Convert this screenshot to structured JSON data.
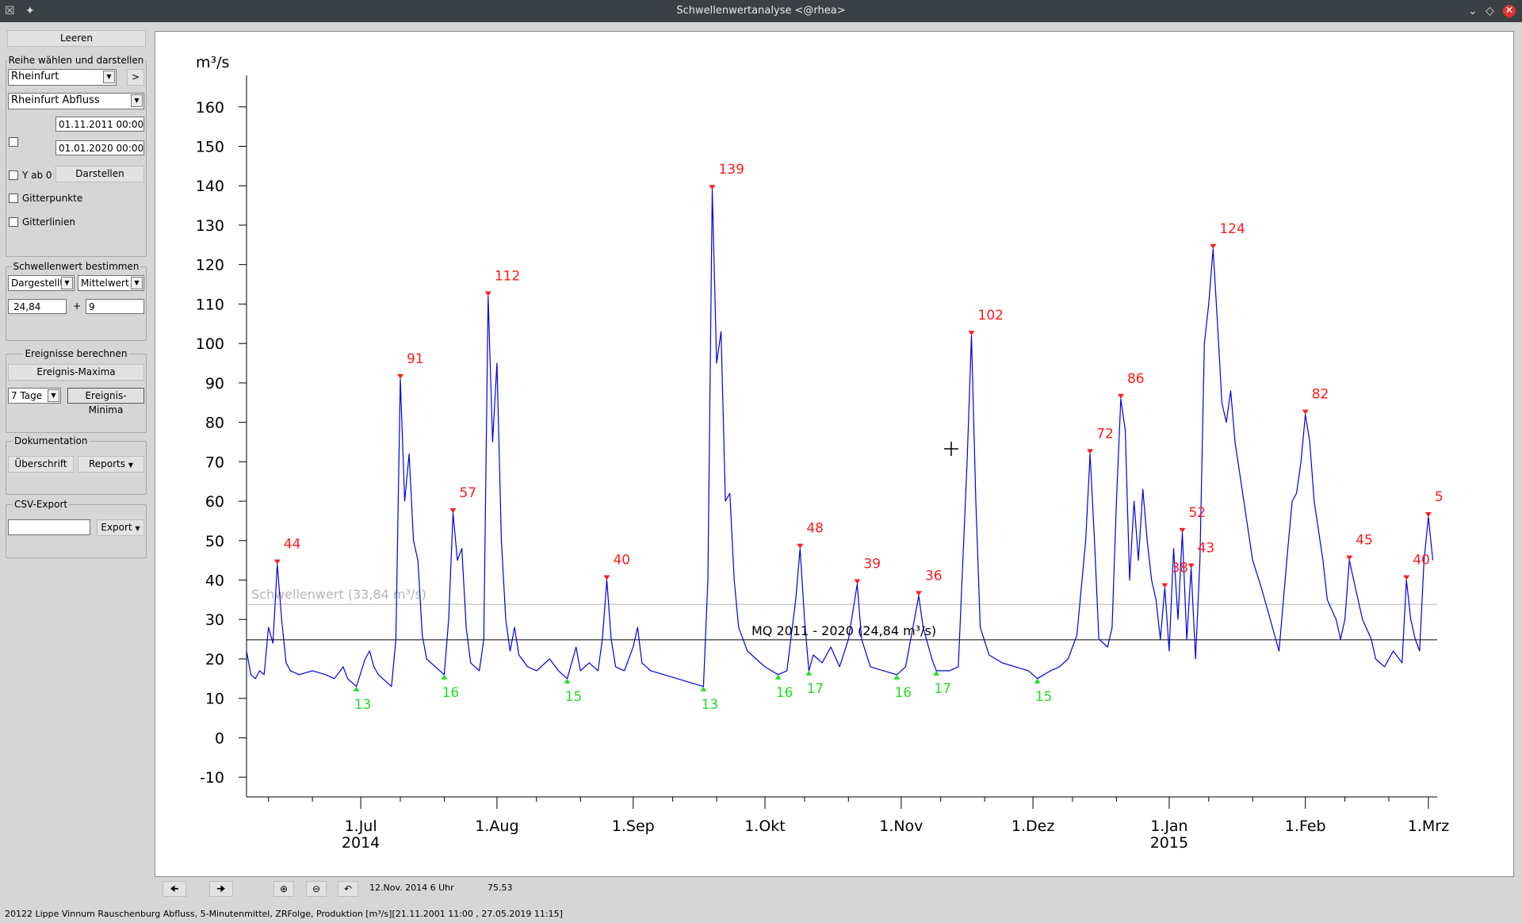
{
  "window": {
    "title": "Schwellenwertanalyse <@rhea>"
  },
  "left": {
    "leeren": "Leeren",
    "reihe": {
      "title": "Reihe wählen und darstellen",
      "station": "Rheinfurt",
      "next": ">",
      "series": "Rheinfurt Abfluss",
      "start": "01.11.2011 00:00",
      "end": "01.01.2020 00:00",
      "yab0": "Y ab 0",
      "darstellen": "Darstellen",
      "gitterpunkte": "Gitterpunkte",
      "gitterlinien": "Gitterlinien"
    },
    "schwelle": {
      "title": "Schwellenwert bestimmen",
      "mode": "Dargestellt",
      "stat": "Mittelwert",
      "value": "24,84",
      "plus": "+",
      "offset": "9"
    },
    "ereignisse": {
      "title": "Ereignisse berechnen",
      "maxima": "Ereignis-Maxima",
      "period": "7 Tage",
      "minima": "Ereignis-Minima"
    },
    "doku": {
      "title": "Dokumentation",
      "ueberschrift": "Überschrift",
      "reports": "Reports"
    },
    "csv": {
      "title": "CSV-Export",
      "value": "",
      "export": "Export"
    }
  },
  "status": {
    "cursor_date": "12.Nov. 2014 6 Uhr",
    "cursor_value": "75.53",
    "footer": "20122 Lippe Vinnum Rauschenburg  Abfluss, 5-Minutenmittel, ZRFolge, Produktion [m³/s][21.11.2001 11:00 , 27.05.2019 11:15]"
  },
  "colors": {
    "series": "#0000dd",
    "maxima": "#ff1a1a",
    "minima": "#22dd22",
    "threshold": "#b4b4b4",
    "mean": "#000000"
  },
  "chart_data": {
    "type": "line",
    "ylabel": "m³/s",
    "ylim": [
      -15,
      168
    ],
    "yticks": [
      -10,
      0,
      10,
      20,
      30,
      40,
      50,
      60,
      70,
      80,
      90,
      100,
      110,
      120,
      130,
      140,
      150,
      160
    ],
    "xlim": [
      "2014-06-05",
      "2015-03-03"
    ],
    "xticks": [
      {
        "date": "2014-07-01",
        "label": "1.Jul",
        "sub": "2014"
      },
      {
        "date": "2014-08-01",
        "label": "1.Aug",
        "sub": ""
      },
      {
        "date": "2014-09-01",
        "label": "1.Sep",
        "sub": ""
      },
      {
        "date": "2014-10-01",
        "label": "1.Okt",
        "sub": ""
      },
      {
        "date": "2014-11-01",
        "label": "1.Nov",
        "sub": ""
      },
      {
        "date": "2014-12-01",
        "label": "1.Dez",
        "sub": ""
      },
      {
        "date": "2015-01-01",
        "label": "1.Jan",
        "sub": "2015"
      },
      {
        "date": "2015-02-01",
        "label": "1.Feb",
        "sub": ""
      },
      {
        "date": "2015-03-01",
        "label": "1.Mrz",
        "sub": ""
      }
    ],
    "minor_ticks": [
      "2014-06-10",
      "2014-06-20",
      "2014-07-10",
      "2014-07-20",
      "2014-08-10",
      "2014-08-20",
      "2014-09-10",
      "2014-09-20",
      "2014-10-10",
      "2014-10-20",
      "2014-11-10",
      "2014-11-20",
      "2014-12-10",
      "2014-12-20",
      "2015-01-10",
      "2015-01-20",
      "2015-02-10",
      "2015-02-20"
    ],
    "threshold": {
      "value": 33.84,
      "label": "Schwellenwert  (33,84 m³/s)"
    },
    "mean": {
      "value": 24.84,
      "label": "MQ 2011 - 2020 (24,84 m³/s)"
    },
    "maxima": [
      {
        "date": "2014-06-12",
        "value": 44,
        "label": "44"
      },
      {
        "date": "2014-07-10",
        "value": 91,
        "label": "91"
      },
      {
        "date": "2014-07-22",
        "value": 57,
        "label": "57"
      },
      {
        "date": "2014-07-30",
        "value": 112,
        "label": "112"
      },
      {
        "date": "2014-08-26",
        "value": 40,
        "label": "40"
      },
      {
        "date": "2014-09-19",
        "value": 139,
        "label": "139"
      },
      {
        "date": "2014-10-09",
        "value": 48,
        "label": "48"
      },
      {
        "date": "2014-10-22",
        "value": 39,
        "label": "39"
      },
      {
        "date": "2014-11-05",
        "value": 36,
        "label": "36"
      },
      {
        "date": "2014-11-17",
        "value": 102,
        "label": "102"
      },
      {
        "date": "2014-12-14",
        "value": 72,
        "label": "72"
      },
      {
        "date": "2014-12-21",
        "value": 86,
        "label": "86"
      },
      {
        "date": "2014-12-31",
        "value": 38,
        "label": "38"
      },
      {
        "date": "2015-01-04",
        "value": 52,
        "label": "52"
      },
      {
        "date": "2015-01-06",
        "value": 43,
        "label": "43"
      },
      {
        "date": "2015-01-11",
        "value": 124,
        "label": "124"
      },
      {
        "date": "2015-02-01",
        "value": 82,
        "label": "82"
      },
      {
        "date": "2015-02-11",
        "value": 45,
        "label": "45"
      },
      {
        "date": "2015-02-24",
        "value": 40,
        "label": "40"
      },
      {
        "date": "2015-03-01",
        "value": 56,
        "label": "5"
      }
    ],
    "minima": [
      {
        "date": "2014-06-30",
        "value": 13,
        "label": "13"
      },
      {
        "date": "2014-07-20",
        "value": 16,
        "label": "16"
      },
      {
        "date": "2014-08-17",
        "value": 15,
        "label": "15"
      },
      {
        "date": "2014-09-17",
        "value": 13,
        "label": "13"
      },
      {
        "date": "2014-10-04",
        "value": 16,
        "label": "16"
      },
      {
        "date": "2014-10-11",
        "value": 17,
        "label": "17"
      },
      {
        "date": "2014-10-31",
        "value": 16,
        "label": "16"
      },
      {
        "date": "2014-11-09",
        "value": 17,
        "label": "17"
      },
      {
        "date": "2014-12-02",
        "value": 15,
        "label": "15"
      }
    ],
    "series": [
      {
        "values": [
          [
            "2014-06-05",
            22
          ],
          [
            "2014-06-06",
            16
          ],
          [
            "2014-06-07",
            15
          ],
          [
            "2014-06-08",
            17
          ],
          [
            "2014-06-09",
            16
          ],
          [
            "2014-06-10",
            28
          ],
          [
            "2014-06-11",
            24
          ],
          [
            "2014-06-12",
            44
          ],
          [
            "2014-06-13",
            30
          ],
          [
            "2014-06-14",
            19
          ],
          [
            "2014-06-15",
            17
          ],
          [
            "2014-06-17",
            16
          ],
          [
            "2014-06-20",
            17
          ],
          [
            "2014-06-23",
            16
          ],
          [
            "2014-06-25",
            15
          ],
          [
            "2014-06-27",
            18
          ],
          [
            "2014-06-28",
            15
          ],
          [
            "2014-06-30",
            13
          ],
          [
            "2014-07-02",
            20
          ],
          [
            "2014-07-03",
            22
          ],
          [
            "2014-07-04",
            18
          ],
          [
            "2014-07-05",
            16
          ],
          [
            "2014-07-07",
            14
          ],
          [
            "2014-07-08",
            13
          ],
          [
            "2014-07-09",
            25
          ],
          [
            "2014-07-10",
            91
          ],
          [
            "2014-07-11",
            60
          ],
          [
            "2014-07-12",
            72
          ],
          [
            "2014-07-13",
            50
          ],
          [
            "2014-07-14",
            45
          ],
          [
            "2014-07-15",
            26
          ],
          [
            "2014-07-16",
            20
          ],
          [
            "2014-07-18",
            18
          ],
          [
            "2014-07-20",
            16
          ],
          [
            "2014-07-21",
            30
          ],
          [
            "2014-07-22",
            57
          ],
          [
            "2014-07-23",
            45
          ],
          [
            "2014-07-24",
            48
          ],
          [
            "2014-07-25",
            28
          ],
          [
            "2014-07-26",
            19
          ],
          [
            "2014-07-28",
            17
          ],
          [
            "2014-07-29",
            25
          ],
          [
            "2014-07-30",
            112
          ],
          [
            "2014-07-31",
            75
          ],
          [
            "2014-08-01",
            95
          ],
          [
            "2014-08-02",
            50
          ],
          [
            "2014-08-03",
            30
          ],
          [
            "2014-08-04",
            22
          ],
          [
            "2014-08-05",
            28
          ],
          [
            "2014-08-06",
            21
          ],
          [
            "2014-08-08",
            18
          ],
          [
            "2014-08-10",
            17
          ],
          [
            "2014-08-13",
            20
          ],
          [
            "2014-08-15",
            17
          ],
          [
            "2014-08-17",
            15
          ],
          [
            "2014-08-19",
            23
          ],
          [
            "2014-08-20",
            17
          ],
          [
            "2014-08-22",
            19
          ],
          [
            "2014-08-24",
            17
          ],
          [
            "2014-08-25",
            25
          ],
          [
            "2014-08-26",
            40
          ],
          [
            "2014-08-27",
            25
          ],
          [
            "2014-08-28",
            18
          ],
          [
            "2014-08-30",
            17
          ],
          [
            "2014-09-01",
            23
          ],
          [
            "2014-09-02",
            28
          ],
          [
            "2014-09-03",
            19
          ],
          [
            "2014-09-05",
            17
          ],
          [
            "2014-09-08",
            16
          ],
          [
            "2014-09-11",
            15
          ],
          [
            "2014-09-14",
            14
          ],
          [
            "2014-09-17",
            13
          ],
          [
            "2014-09-18",
            40
          ],
          [
            "2014-09-19",
            139
          ],
          [
            "2014-09-20",
            95
          ],
          [
            "2014-09-21",
            103
          ],
          [
            "2014-09-22",
            60
          ],
          [
            "2014-09-23",
            62
          ],
          [
            "2014-09-24",
            40
          ],
          [
            "2014-09-25",
            28
          ],
          [
            "2014-09-27",
            22
          ],
          [
            "2014-09-29",
            20
          ],
          [
            "2014-10-01",
            18
          ],
          [
            "2014-10-04",
            16
          ],
          [
            "2014-10-06",
            17
          ],
          [
            "2014-10-08",
            35
          ],
          [
            "2014-10-09",
            48
          ],
          [
            "2014-10-10",
            30
          ],
          [
            "2014-10-11",
            17
          ],
          [
            "2014-10-12",
            21
          ],
          [
            "2014-10-14",
            19
          ],
          [
            "2014-10-16",
            23
          ],
          [
            "2014-10-18",
            18
          ],
          [
            "2014-10-20",
            25
          ],
          [
            "2014-10-22",
            39
          ],
          [
            "2014-10-23",
            25
          ],
          [
            "2014-10-25",
            18
          ],
          [
            "2014-10-28",
            17
          ],
          [
            "2014-10-31",
            16
          ],
          [
            "2014-11-02",
            18
          ],
          [
            "2014-11-04",
            30
          ],
          [
            "2014-11-05",
            36
          ],
          [
            "2014-11-06",
            28
          ],
          [
            "2014-11-08",
            20
          ],
          [
            "2014-11-09",
            17
          ],
          [
            "2014-11-12",
            17
          ],
          [
            "2014-11-14",
            18
          ],
          [
            "2014-11-16",
            70
          ],
          [
            "2014-11-17",
            102
          ],
          [
            "2014-11-18",
            60
          ],
          [
            "2014-11-19",
            28
          ],
          [
            "2014-11-21",
            21
          ],
          [
            "2014-11-24",
            19
          ],
          [
            "2014-11-27",
            18
          ],
          [
            "2014-11-30",
            17
          ],
          [
            "2014-12-02",
            15
          ],
          [
            "2014-12-05",
            17
          ],
          [
            "2014-12-07",
            18
          ],
          [
            "2014-12-09",
            20
          ],
          [
            "2014-12-11",
            26
          ],
          [
            "2014-12-13",
            50
          ],
          [
            "2014-12-14",
            72
          ],
          [
            "2014-12-15",
            50
          ],
          [
            "2014-12-16",
            25
          ],
          [
            "2014-12-18",
            23
          ],
          [
            "2014-12-19",
            28
          ],
          [
            "2014-12-20",
            60
          ],
          [
            "2014-12-21",
            86
          ],
          [
            "2014-12-22",
            78
          ],
          [
            "2014-12-23",
            40
          ],
          [
            "2014-12-24",
            60
          ],
          [
            "2014-12-25",
            45
          ],
          [
            "2014-12-26",
            63
          ],
          [
            "2014-12-27",
            50
          ],
          [
            "2014-12-28",
            40
          ],
          [
            "2014-12-29",
            35
          ],
          [
            "2014-12-30",
            25
          ],
          [
            "2014-12-31",
            38
          ],
          [
            "2015-01-01",
            22
          ],
          [
            "2015-01-02",
            48
          ],
          [
            "2015-01-03",
            30
          ],
          [
            "2015-01-04",
            52
          ],
          [
            "2015-01-05",
            25
          ],
          [
            "2015-01-06",
            43
          ],
          [
            "2015-01-07",
            20
          ],
          [
            "2015-01-08",
            45
          ],
          [
            "2015-01-09",
            100
          ],
          [
            "2015-01-10",
            110
          ],
          [
            "2015-01-11",
            124
          ],
          [
            "2015-01-12",
            105
          ],
          [
            "2015-01-13",
            85
          ],
          [
            "2015-01-14",
            80
          ],
          [
            "2015-01-15",
            88
          ],
          [
            "2015-01-16",
            75
          ],
          [
            "2015-01-18",
            60
          ],
          [
            "2015-01-20",
            45
          ],
          [
            "2015-01-22",
            38
          ],
          [
            "2015-01-24",
            30
          ],
          [
            "2015-01-26",
            22
          ],
          [
            "2015-01-28",
            48
          ],
          [
            "2015-01-29",
            60
          ],
          [
            "2015-01-30",
            62
          ],
          [
            "2015-01-31",
            70
          ],
          [
            "2015-02-01",
            82
          ],
          [
            "2015-02-02",
            75
          ],
          [
            "2015-02-03",
            60
          ],
          [
            "2015-02-05",
            45
          ],
          [
            "2015-02-06",
            35
          ],
          [
            "2015-02-08",
            30
          ],
          [
            "2015-02-09",
            25
          ],
          [
            "2015-02-10",
            30
          ],
          [
            "2015-02-11",
            45
          ],
          [
            "2015-02-12",
            40
          ],
          [
            "2015-02-13",
            35
          ],
          [
            "2015-02-14",
            30
          ],
          [
            "2015-02-16",
            25
          ],
          [
            "2015-02-17",
            20
          ],
          [
            "2015-02-19",
            18
          ],
          [
            "2015-02-21",
            22
          ],
          [
            "2015-02-23",
            19
          ],
          [
            "2015-02-24",
            40
          ],
          [
            "2015-02-25",
            30
          ],
          [
            "2015-02-26",
            25
          ],
          [
            "2015-02-27",
            22
          ],
          [
            "2015-02-28",
            45
          ],
          [
            "2015-03-01",
            56
          ],
          [
            "2015-03-02",
            45
          ]
        ]
      }
    ]
  }
}
